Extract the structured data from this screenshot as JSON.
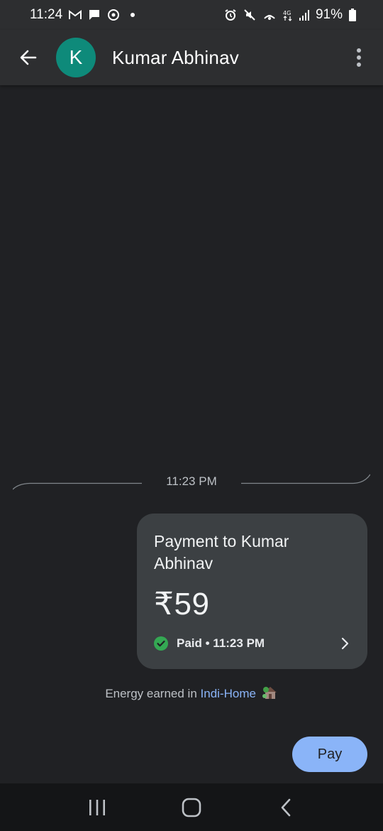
{
  "status_bar": {
    "time": "11:24",
    "battery": "91%",
    "icons_left": [
      "gmail-icon",
      "message-icon",
      "sync-icon",
      "dot-icon"
    ],
    "icons_right": [
      "alarm-icon",
      "mute-icon",
      "hotspot-icon",
      "network-4g-icon",
      "signal-icon",
      "battery-icon"
    ]
  },
  "header": {
    "avatar_letter": "K",
    "contact_name": "Kumar Abhinav",
    "avatar_color": "#0e8a7a"
  },
  "chat": {
    "time_divider": "11:23 PM",
    "payment_card": {
      "title": "Payment to Kumar Abhinav",
      "amount": "₹59",
      "status": "Paid • 11:23 PM"
    },
    "energy_prefix": "Energy earned in",
    "energy_link": "Indi-Home"
  },
  "pay_button": {
    "label": "Pay"
  },
  "colors": {
    "background": "#202124",
    "card": "#3c4043",
    "accent": "#8ab4f8",
    "success": "#34a853"
  }
}
